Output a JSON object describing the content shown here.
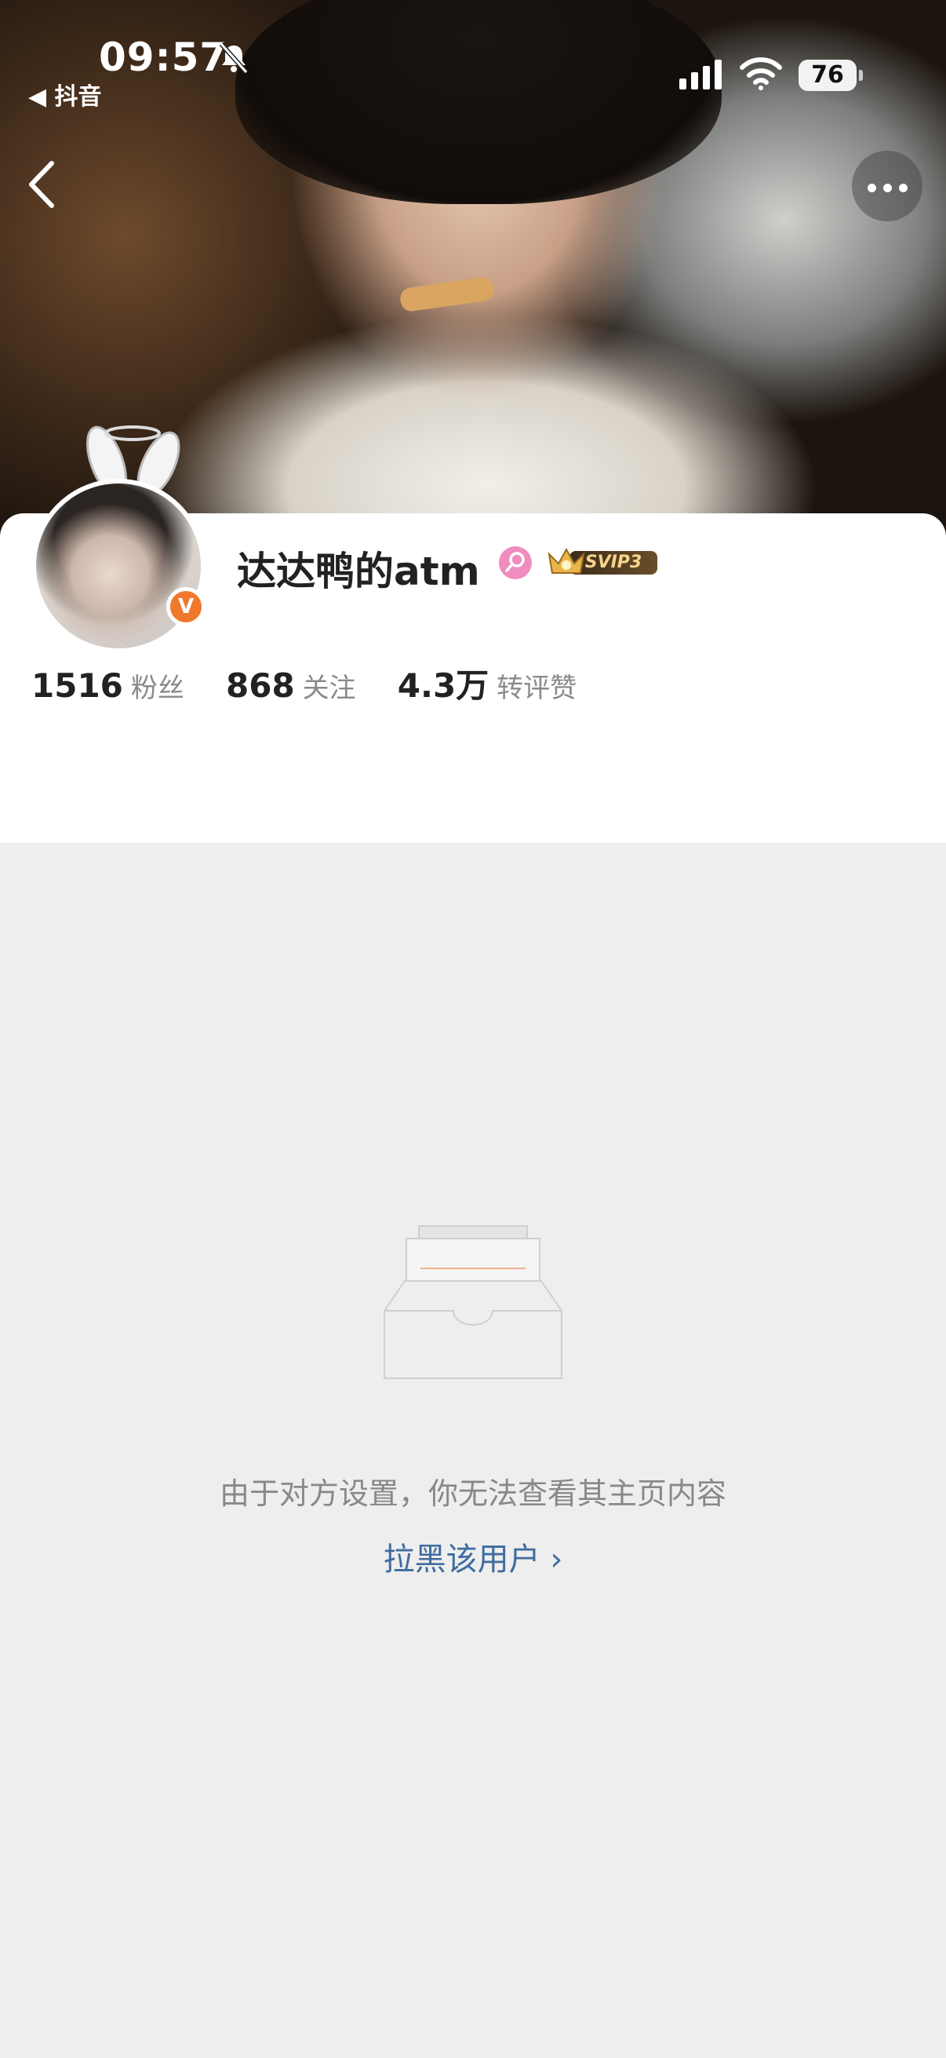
{
  "status_bar": {
    "time": "09:57",
    "back_app": "◀ 抖音",
    "battery": "76"
  },
  "profile": {
    "username": "达达鸭的atm",
    "verified_badge": "V",
    "vip_badge": "SVIP3",
    "stats": [
      {
        "value": "1516",
        "label": "粉丝"
      },
      {
        "value": "868",
        "label": "关注"
      },
      {
        "value": "4.3万",
        "label": "转评赞"
      }
    ]
  },
  "empty_state": {
    "message": "由于对方设置，你无法查看其主页内容",
    "block_link": "拉黑该用户 ›"
  },
  "colors": {
    "accent_link": "#3f6c9f",
    "verified_orange": "#f0782c",
    "background": "#eeeeee"
  }
}
